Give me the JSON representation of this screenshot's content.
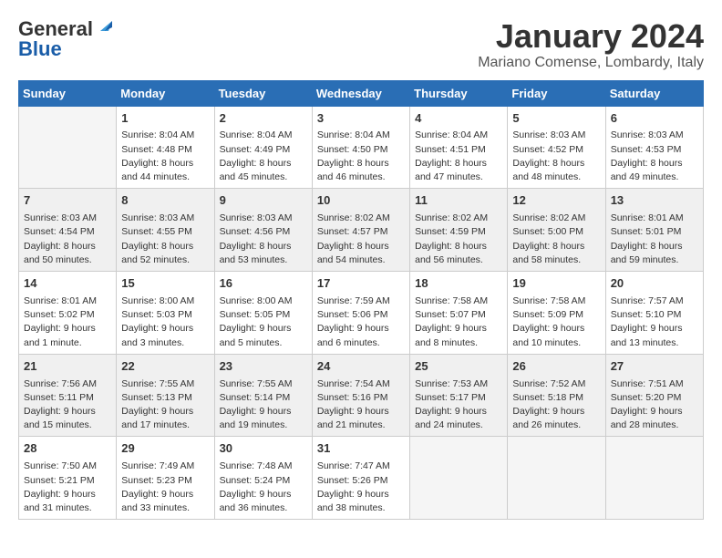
{
  "logo": {
    "general": "General",
    "blue": "Blue"
  },
  "title": "January 2024",
  "location": "Mariano Comense, Lombardy, Italy",
  "days_header": [
    "Sunday",
    "Monday",
    "Tuesday",
    "Wednesday",
    "Thursday",
    "Friday",
    "Saturday"
  ],
  "weeks": [
    [
      {
        "num": "",
        "info": ""
      },
      {
        "num": "1",
        "info": "Sunrise: 8:04 AM\nSunset: 4:48 PM\nDaylight: 8 hours\nand 44 minutes."
      },
      {
        "num": "2",
        "info": "Sunrise: 8:04 AM\nSunset: 4:49 PM\nDaylight: 8 hours\nand 45 minutes."
      },
      {
        "num": "3",
        "info": "Sunrise: 8:04 AM\nSunset: 4:50 PM\nDaylight: 8 hours\nand 46 minutes."
      },
      {
        "num": "4",
        "info": "Sunrise: 8:04 AM\nSunset: 4:51 PM\nDaylight: 8 hours\nand 47 minutes."
      },
      {
        "num": "5",
        "info": "Sunrise: 8:03 AM\nSunset: 4:52 PM\nDaylight: 8 hours\nand 48 minutes."
      },
      {
        "num": "6",
        "info": "Sunrise: 8:03 AM\nSunset: 4:53 PM\nDaylight: 8 hours\nand 49 minutes."
      }
    ],
    [
      {
        "num": "7",
        "info": "Sunrise: 8:03 AM\nSunset: 4:54 PM\nDaylight: 8 hours\nand 50 minutes."
      },
      {
        "num": "8",
        "info": "Sunrise: 8:03 AM\nSunset: 4:55 PM\nDaylight: 8 hours\nand 52 minutes."
      },
      {
        "num": "9",
        "info": "Sunrise: 8:03 AM\nSunset: 4:56 PM\nDaylight: 8 hours\nand 53 minutes."
      },
      {
        "num": "10",
        "info": "Sunrise: 8:02 AM\nSunset: 4:57 PM\nDaylight: 8 hours\nand 54 minutes."
      },
      {
        "num": "11",
        "info": "Sunrise: 8:02 AM\nSunset: 4:59 PM\nDaylight: 8 hours\nand 56 minutes."
      },
      {
        "num": "12",
        "info": "Sunrise: 8:02 AM\nSunset: 5:00 PM\nDaylight: 8 hours\nand 58 minutes."
      },
      {
        "num": "13",
        "info": "Sunrise: 8:01 AM\nSunset: 5:01 PM\nDaylight: 8 hours\nand 59 minutes."
      }
    ],
    [
      {
        "num": "14",
        "info": "Sunrise: 8:01 AM\nSunset: 5:02 PM\nDaylight: 9 hours\nand 1 minute."
      },
      {
        "num": "15",
        "info": "Sunrise: 8:00 AM\nSunset: 5:03 PM\nDaylight: 9 hours\nand 3 minutes."
      },
      {
        "num": "16",
        "info": "Sunrise: 8:00 AM\nSunset: 5:05 PM\nDaylight: 9 hours\nand 5 minutes."
      },
      {
        "num": "17",
        "info": "Sunrise: 7:59 AM\nSunset: 5:06 PM\nDaylight: 9 hours\nand 6 minutes."
      },
      {
        "num": "18",
        "info": "Sunrise: 7:58 AM\nSunset: 5:07 PM\nDaylight: 9 hours\nand 8 minutes."
      },
      {
        "num": "19",
        "info": "Sunrise: 7:58 AM\nSunset: 5:09 PM\nDaylight: 9 hours\nand 10 minutes."
      },
      {
        "num": "20",
        "info": "Sunrise: 7:57 AM\nSunset: 5:10 PM\nDaylight: 9 hours\nand 13 minutes."
      }
    ],
    [
      {
        "num": "21",
        "info": "Sunrise: 7:56 AM\nSunset: 5:11 PM\nDaylight: 9 hours\nand 15 minutes."
      },
      {
        "num": "22",
        "info": "Sunrise: 7:55 AM\nSunset: 5:13 PM\nDaylight: 9 hours\nand 17 minutes."
      },
      {
        "num": "23",
        "info": "Sunrise: 7:55 AM\nSunset: 5:14 PM\nDaylight: 9 hours\nand 19 minutes."
      },
      {
        "num": "24",
        "info": "Sunrise: 7:54 AM\nSunset: 5:16 PM\nDaylight: 9 hours\nand 21 minutes."
      },
      {
        "num": "25",
        "info": "Sunrise: 7:53 AM\nSunset: 5:17 PM\nDaylight: 9 hours\nand 24 minutes."
      },
      {
        "num": "26",
        "info": "Sunrise: 7:52 AM\nSunset: 5:18 PM\nDaylight: 9 hours\nand 26 minutes."
      },
      {
        "num": "27",
        "info": "Sunrise: 7:51 AM\nSunset: 5:20 PM\nDaylight: 9 hours\nand 28 minutes."
      }
    ],
    [
      {
        "num": "28",
        "info": "Sunrise: 7:50 AM\nSunset: 5:21 PM\nDaylight: 9 hours\nand 31 minutes."
      },
      {
        "num": "29",
        "info": "Sunrise: 7:49 AM\nSunset: 5:23 PM\nDaylight: 9 hours\nand 33 minutes."
      },
      {
        "num": "30",
        "info": "Sunrise: 7:48 AM\nSunset: 5:24 PM\nDaylight: 9 hours\nand 36 minutes."
      },
      {
        "num": "31",
        "info": "Sunrise: 7:47 AM\nSunset: 5:26 PM\nDaylight: 9 hours\nand 38 minutes."
      },
      {
        "num": "",
        "info": ""
      },
      {
        "num": "",
        "info": ""
      },
      {
        "num": "",
        "info": ""
      }
    ]
  ]
}
